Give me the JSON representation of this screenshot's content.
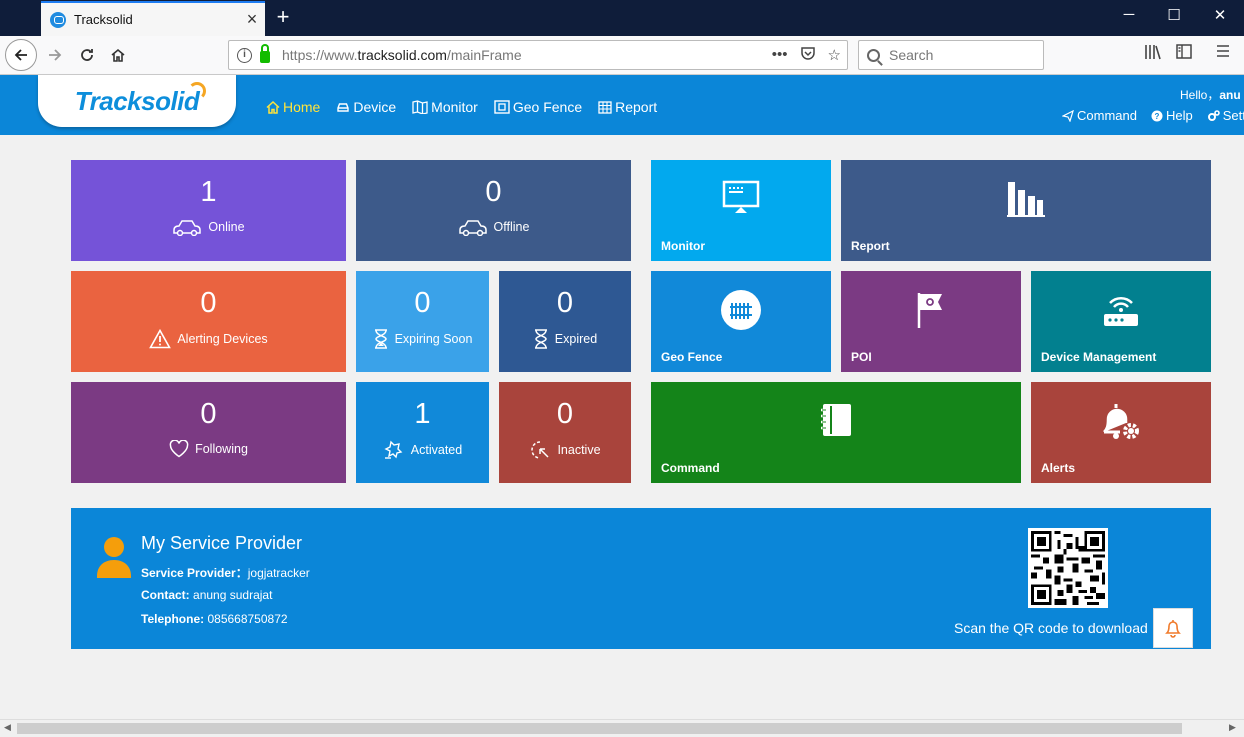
{
  "browser": {
    "tab_title": "Tracksolid",
    "url_prefix": "https://www.",
    "url_host": "tracksolid.com",
    "url_path": "/mainFrame",
    "search_placeholder": "Search",
    "window_controls": {
      "minimize": "─",
      "maximize": "☐",
      "close": "✕"
    }
  },
  "header": {
    "logo_text": "Tracksolid",
    "nav": [
      {
        "label": "Home",
        "icon": "home-icon",
        "active": true
      },
      {
        "label": "Device",
        "icon": "car-icon"
      },
      {
        "label": "Monitor",
        "icon": "map-icon"
      },
      {
        "label": "Geo Fence",
        "icon": "geofence-icon"
      },
      {
        "label": "Report",
        "icon": "table-icon"
      }
    ],
    "hello": "Hello，",
    "username": "anu",
    "top_links": [
      {
        "label": "Command",
        "icon": "send-icon"
      },
      {
        "label": "Help",
        "icon": "help-icon"
      },
      {
        "label": "Sett",
        "icon": "settings-icon"
      }
    ]
  },
  "status_tiles": {
    "online": {
      "value": "1",
      "label": "Online"
    },
    "offline": {
      "value": "0",
      "label": "Offline"
    },
    "alerting": {
      "value": "0",
      "label": "Alerting Devices"
    },
    "expiring": {
      "value": "0",
      "label": "Expiring Soon"
    },
    "expired": {
      "value": "0",
      "label": "Expired"
    },
    "following": {
      "value": "0",
      "label": "Following"
    },
    "activated": {
      "value": "1",
      "label": "Activated"
    },
    "inactive": {
      "value": "0",
      "label": "Inactive"
    }
  },
  "module_tiles": {
    "monitor": "Monitor",
    "report": "Report",
    "geofence": "Geo Fence",
    "poi": "POI",
    "device_management": "Device Management",
    "command": "Command",
    "alerts": "Alerts"
  },
  "colors": {
    "header_blue": "#0b86d8",
    "online": "#7553d8",
    "offline": "#3d5a8a",
    "alerting": "#ea6340",
    "expiring": "#3aa2e9",
    "expired": "#2e5893",
    "following": "#7b3a83",
    "activated": "#1189d9",
    "inactive": "#a9443c",
    "monitor": "#02a9ee",
    "report": "#3d5a8a",
    "geofence": "#1189d9",
    "poi": "#7b3a83",
    "device_management": "#02808f",
    "command": "#148419",
    "alerts": "#a9443c"
  },
  "service_provider": {
    "title": "My Service Provider",
    "provider_label": "Service Provider：",
    "provider_value": "jogjatracker",
    "contact_label": "Contact:",
    "contact_value": "anung sudrajat",
    "telephone_label": "Telephone:",
    "telephone_value": "085668750872",
    "qr_caption": "Scan the QR code to download"
  }
}
